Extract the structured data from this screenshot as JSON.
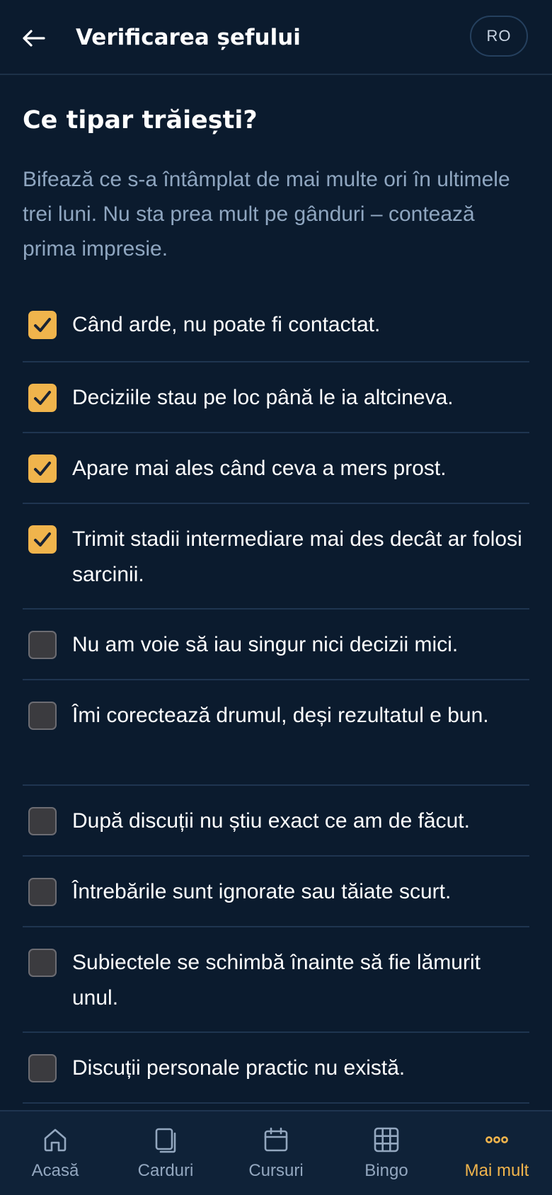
{
  "header": {
    "title": "Verificarea șefului",
    "language": "RO"
  },
  "main": {
    "heading": "Ce tipar trăiești?",
    "intro": "Bifează ce s-a întâmplat de mai multe ori în ultimele trei luni. Nu sta prea mult pe gânduri – contează prima impresie.",
    "items": [
      {
        "label": "Când arde, nu poate fi contactat.",
        "checked": true
      },
      {
        "label": "Deciziile stau pe loc până le ia altcineva.",
        "checked": true
      },
      {
        "label": "Apare mai ales când ceva a mers prost.",
        "checked": true
      },
      {
        "label": "Trimit stadii intermediare mai des decât ar folosi sarcinii.",
        "checked": true
      },
      {
        "label": "Nu am voie să iau singur nici decizii mici.",
        "checked": false
      },
      {
        "label": "Îmi corectează drumul, deși rezultatul e bun.",
        "checked": false
      },
      {
        "label": "După discuții nu știu exact ce am de făcut.",
        "checked": false
      },
      {
        "label": "Întrebările sunt ignorate sau tăiate scurt.",
        "checked": false
      },
      {
        "label": "Subiectele se schimbă înainte să fie lămurit unul.",
        "checked": false
      },
      {
        "label": "Discuții personale practic nu există.",
        "checked": false
      }
    ]
  },
  "nav": {
    "items": [
      {
        "label": "Acasă",
        "icon": "home-icon",
        "active": false
      },
      {
        "label": "Carduri",
        "icon": "cards-icon",
        "active": false
      },
      {
        "label": "Cursuri",
        "icon": "calendar-icon",
        "active": false
      },
      {
        "label": "Bingo",
        "icon": "grid-icon",
        "active": false
      },
      {
        "label": "Mai mult",
        "icon": "more-icon",
        "active": true
      }
    ]
  },
  "colors": {
    "background": "#0b1b2e",
    "accent": "#f0b44c",
    "muted_text": "#8fa6c0",
    "divider": "#1f3550"
  }
}
